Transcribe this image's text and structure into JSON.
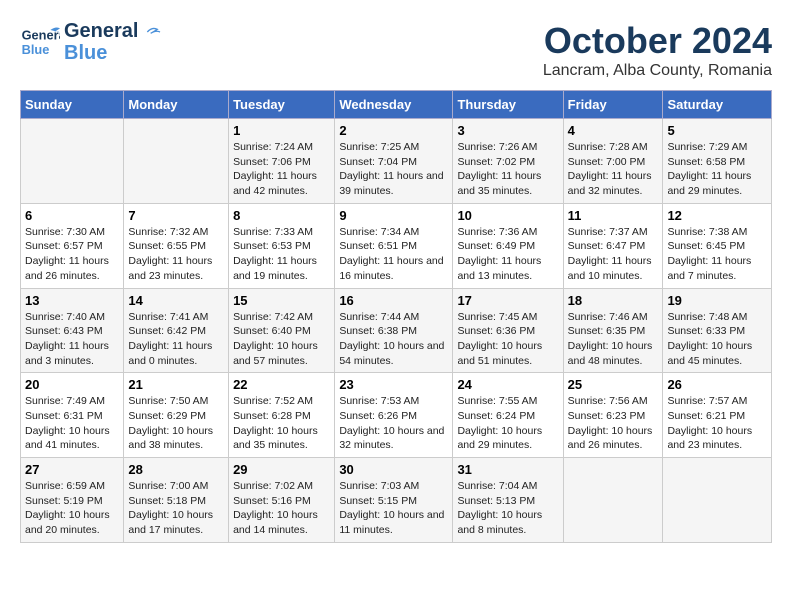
{
  "header": {
    "logo_general": "General",
    "logo_blue": "Blue",
    "month": "October 2024",
    "location": "Lancram, Alba County, Romania"
  },
  "days_of_week": [
    "Sunday",
    "Monday",
    "Tuesday",
    "Wednesday",
    "Thursday",
    "Friday",
    "Saturday"
  ],
  "weeks": [
    [
      {
        "day": "",
        "info": ""
      },
      {
        "day": "",
        "info": ""
      },
      {
        "day": "1",
        "info": "Sunrise: 7:24 AM\nSunset: 7:06 PM\nDaylight: 11 hours and 42 minutes."
      },
      {
        "day": "2",
        "info": "Sunrise: 7:25 AM\nSunset: 7:04 PM\nDaylight: 11 hours and 39 minutes."
      },
      {
        "day": "3",
        "info": "Sunrise: 7:26 AM\nSunset: 7:02 PM\nDaylight: 11 hours and 35 minutes."
      },
      {
        "day": "4",
        "info": "Sunrise: 7:28 AM\nSunset: 7:00 PM\nDaylight: 11 hours and 32 minutes."
      },
      {
        "day": "5",
        "info": "Sunrise: 7:29 AM\nSunset: 6:58 PM\nDaylight: 11 hours and 29 minutes."
      }
    ],
    [
      {
        "day": "6",
        "info": "Sunrise: 7:30 AM\nSunset: 6:57 PM\nDaylight: 11 hours and 26 minutes."
      },
      {
        "day": "7",
        "info": "Sunrise: 7:32 AM\nSunset: 6:55 PM\nDaylight: 11 hours and 23 minutes."
      },
      {
        "day": "8",
        "info": "Sunrise: 7:33 AM\nSunset: 6:53 PM\nDaylight: 11 hours and 19 minutes."
      },
      {
        "day": "9",
        "info": "Sunrise: 7:34 AM\nSunset: 6:51 PM\nDaylight: 11 hours and 16 minutes."
      },
      {
        "day": "10",
        "info": "Sunrise: 7:36 AM\nSunset: 6:49 PM\nDaylight: 11 hours and 13 minutes."
      },
      {
        "day": "11",
        "info": "Sunrise: 7:37 AM\nSunset: 6:47 PM\nDaylight: 11 hours and 10 minutes."
      },
      {
        "day": "12",
        "info": "Sunrise: 7:38 AM\nSunset: 6:45 PM\nDaylight: 11 hours and 7 minutes."
      }
    ],
    [
      {
        "day": "13",
        "info": "Sunrise: 7:40 AM\nSunset: 6:43 PM\nDaylight: 11 hours and 3 minutes."
      },
      {
        "day": "14",
        "info": "Sunrise: 7:41 AM\nSunset: 6:42 PM\nDaylight: 11 hours and 0 minutes."
      },
      {
        "day": "15",
        "info": "Sunrise: 7:42 AM\nSunset: 6:40 PM\nDaylight: 10 hours and 57 minutes."
      },
      {
        "day": "16",
        "info": "Sunrise: 7:44 AM\nSunset: 6:38 PM\nDaylight: 10 hours and 54 minutes."
      },
      {
        "day": "17",
        "info": "Sunrise: 7:45 AM\nSunset: 6:36 PM\nDaylight: 10 hours and 51 minutes."
      },
      {
        "day": "18",
        "info": "Sunrise: 7:46 AM\nSunset: 6:35 PM\nDaylight: 10 hours and 48 minutes."
      },
      {
        "day": "19",
        "info": "Sunrise: 7:48 AM\nSunset: 6:33 PM\nDaylight: 10 hours and 45 minutes."
      }
    ],
    [
      {
        "day": "20",
        "info": "Sunrise: 7:49 AM\nSunset: 6:31 PM\nDaylight: 10 hours and 41 minutes."
      },
      {
        "day": "21",
        "info": "Sunrise: 7:50 AM\nSunset: 6:29 PM\nDaylight: 10 hours and 38 minutes."
      },
      {
        "day": "22",
        "info": "Sunrise: 7:52 AM\nSunset: 6:28 PM\nDaylight: 10 hours and 35 minutes."
      },
      {
        "day": "23",
        "info": "Sunrise: 7:53 AM\nSunset: 6:26 PM\nDaylight: 10 hours and 32 minutes."
      },
      {
        "day": "24",
        "info": "Sunrise: 7:55 AM\nSunset: 6:24 PM\nDaylight: 10 hours and 29 minutes."
      },
      {
        "day": "25",
        "info": "Sunrise: 7:56 AM\nSunset: 6:23 PM\nDaylight: 10 hours and 26 minutes."
      },
      {
        "day": "26",
        "info": "Sunrise: 7:57 AM\nSunset: 6:21 PM\nDaylight: 10 hours and 23 minutes."
      }
    ],
    [
      {
        "day": "27",
        "info": "Sunrise: 6:59 AM\nSunset: 5:19 PM\nDaylight: 10 hours and 20 minutes."
      },
      {
        "day": "28",
        "info": "Sunrise: 7:00 AM\nSunset: 5:18 PM\nDaylight: 10 hours and 17 minutes."
      },
      {
        "day": "29",
        "info": "Sunrise: 7:02 AM\nSunset: 5:16 PM\nDaylight: 10 hours and 14 minutes."
      },
      {
        "day": "30",
        "info": "Sunrise: 7:03 AM\nSunset: 5:15 PM\nDaylight: 10 hours and 11 minutes."
      },
      {
        "day": "31",
        "info": "Sunrise: 7:04 AM\nSunset: 5:13 PM\nDaylight: 10 hours and 8 minutes."
      },
      {
        "day": "",
        "info": ""
      },
      {
        "day": "",
        "info": ""
      }
    ]
  ]
}
